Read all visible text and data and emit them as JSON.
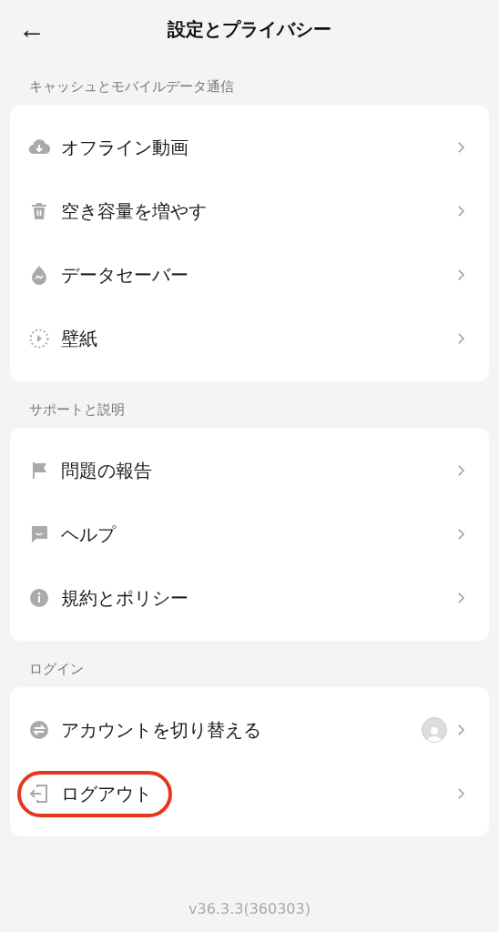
{
  "header": {
    "back": "←",
    "title": "設定とプライバシー"
  },
  "sections": [
    {
      "title": "キャッシュとモバイルデータ通信",
      "items": [
        {
          "label": "オフライン動画",
          "kind": "cloud",
          "avatar": false,
          "highlighted": false
        },
        {
          "label": "空き容量を増やす",
          "kind": "trash",
          "avatar": false,
          "highlighted": false
        },
        {
          "label": "データセーバー",
          "kind": "drop",
          "avatar": false,
          "highlighted": false
        },
        {
          "label": "壁紙",
          "kind": "wallpaper",
          "avatar": false,
          "highlighted": false
        }
      ]
    },
    {
      "title": "サポートと説明",
      "items": [
        {
          "label": "問題の報告",
          "kind": "flag",
          "avatar": false,
          "highlighted": false
        },
        {
          "label": "ヘルプ",
          "kind": "chat",
          "avatar": false,
          "highlighted": false
        },
        {
          "label": "規約とポリシー",
          "kind": "info",
          "avatar": false,
          "highlighted": false
        }
      ]
    },
    {
      "title": "ログイン",
      "items": [
        {
          "label": "アカウントを切り替える",
          "kind": "switch",
          "avatar": true,
          "highlighted": false
        },
        {
          "label": "ログアウト",
          "kind": "logout",
          "avatar": false,
          "highlighted": true
        }
      ]
    }
  ],
  "version": "v36.3.3(360303)"
}
